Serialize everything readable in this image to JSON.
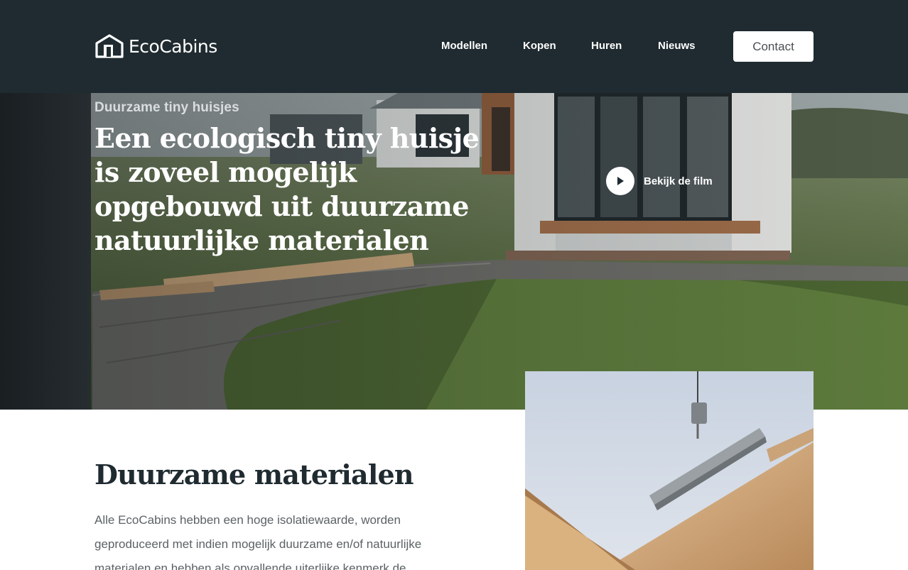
{
  "header": {
    "brand": "EcoCabins",
    "nav": [
      {
        "label": "Modellen"
      },
      {
        "label": "Kopen"
      },
      {
        "label": "Huren"
      },
      {
        "label": "Nieuws"
      }
    ],
    "contact_label": "Contact",
    "background": "#1f2b30"
  },
  "hero": {
    "eyebrow": "Duurzame tiny huisjes",
    "title": "Een ecologisch tiny huisje is zoveel mogelijk opgebouwd uit duurzame natuurlijke materialen",
    "video_label": "Bekijk de film",
    "play_icon": "play-icon"
  },
  "content": {
    "title": "Duurzame materialen",
    "body": "Alle EcoCabins hebben een hoge isolatiewaarde, worden geproduceerd met indien mogelijk duurzame en/of natuurlijke materialen en hebben als opvallende uiterlijke kenmerk de"
  }
}
